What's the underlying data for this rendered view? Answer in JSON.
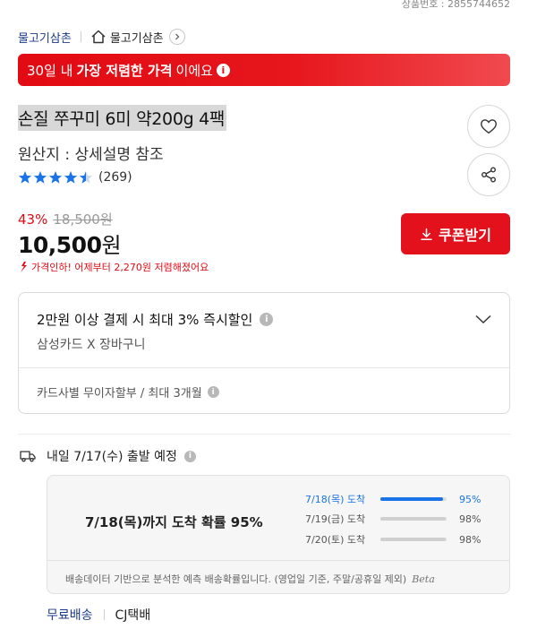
{
  "product_code": "상품번호 : 2855744652",
  "breadcrumb": {
    "category": "물고기삼촌",
    "store": "물고기삼촌"
  },
  "banner": {
    "prefix": "30일 내",
    "highlight": "가장 저렴한 가격",
    "suffix": "이에요",
    "info": "i"
  },
  "product": {
    "title": "손질 쭈꾸미 6미 약200g 4팩",
    "origin": "원산지 : 상세설명 참조",
    "rating_value": 4.5,
    "rating_count": "(269)"
  },
  "price": {
    "discount_rate": "43%",
    "original": "18,500원",
    "sale_number": "10,500",
    "sale_unit": "원",
    "drop_note": "가격인하! 어제부터 2,270원 저렴해졌어요"
  },
  "coupon": {
    "label": "쿠폰받기"
  },
  "card_benefit": {
    "title": "2만원 이상 결제 시 최대 3% 즉시할인",
    "subtitle": "삼성카드 X 장바구니",
    "installment": "카드사별 무이자할부 / 최대 3개월",
    "info": "i"
  },
  "shipping": {
    "departure": "내일 7/17(수) 출발 예정",
    "info": "i",
    "arrival_headline": "7/18(목)까지 도착 확률 95%",
    "probabilities": [
      {
        "date": "7/18(목) 도착",
        "percent": 95,
        "label": "95%"
      },
      {
        "date": "7/19(금) 도착",
        "percent": 98,
        "label": "98%"
      },
      {
        "date": "7/20(토) 도착",
        "percent": 98,
        "label": "98%"
      }
    ],
    "note": "배송데이터 기반으로 분석한 예측 배송확률입니다. (영업일 기준, 주말/공휴일 제외)",
    "beta": "Beta",
    "free_shipping": "무료배송",
    "courier": "CJ택배"
  },
  "colors": {
    "accent_red": "#e2111b",
    "link_blue": "#1c3b8a",
    "prob_blue": "#1a73e8",
    "star_blue": "#1a73e8"
  },
  "icons": [
    "home-icon",
    "chevron-right-icon",
    "info-icon",
    "heart-icon",
    "share-icon",
    "download-icon",
    "chevron-down-icon",
    "truck-icon",
    "arrow-down-icon",
    "star-icon"
  ]
}
